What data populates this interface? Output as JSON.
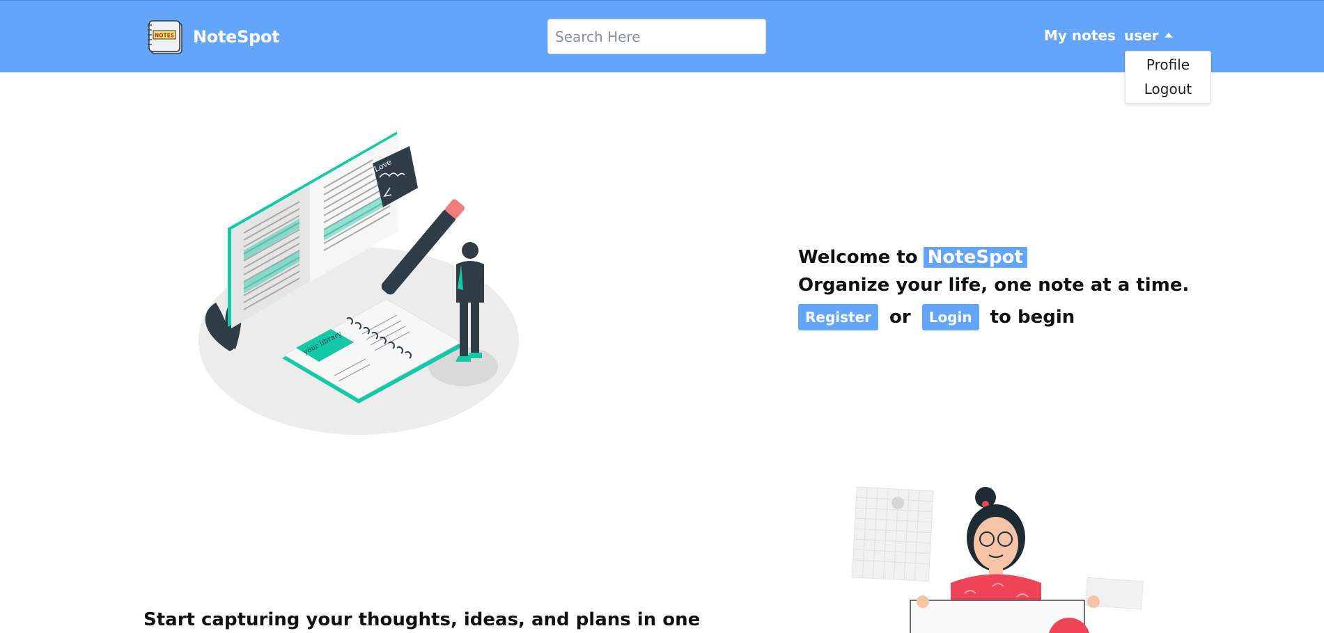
{
  "app": {
    "name": "NoteSpot",
    "logo_text": "NOTES"
  },
  "search": {
    "placeholder": "Search Here",
    "value": ""
  },
  "nav": {
    "my_notes": "My notes",
    "user": "user"
  },
  "user_menu": {
    "profile": "Profile",
    "logout": "Logout"
  },
  "hero": {
    "welcome_prefix": "Welcome to",
    "brand": "NoteSpot",
    "tagline": "Organize your life, one note at a time.",
    "register_label": "Register",
    "or_text": "or",
    "login_label": "Login",
    "suffix": "to begin"
  },
  "illustrations": {
    "notebook_sticky_text": "Love",
    "notebook_note_text": "your library"
  },
  "section2": {
    "text": "Start capturing your thoughts, ideas, and plans in one"
  },
  "colors": {
    "primary": "#62a5fa",
    "accent_teal": "#14c9a8",
    "accent_red": "#ef4358"
  },
  "icons": {
    "caret": "caret-up-icon",
    "logo": "notebook-logo-icon"
  }
}
